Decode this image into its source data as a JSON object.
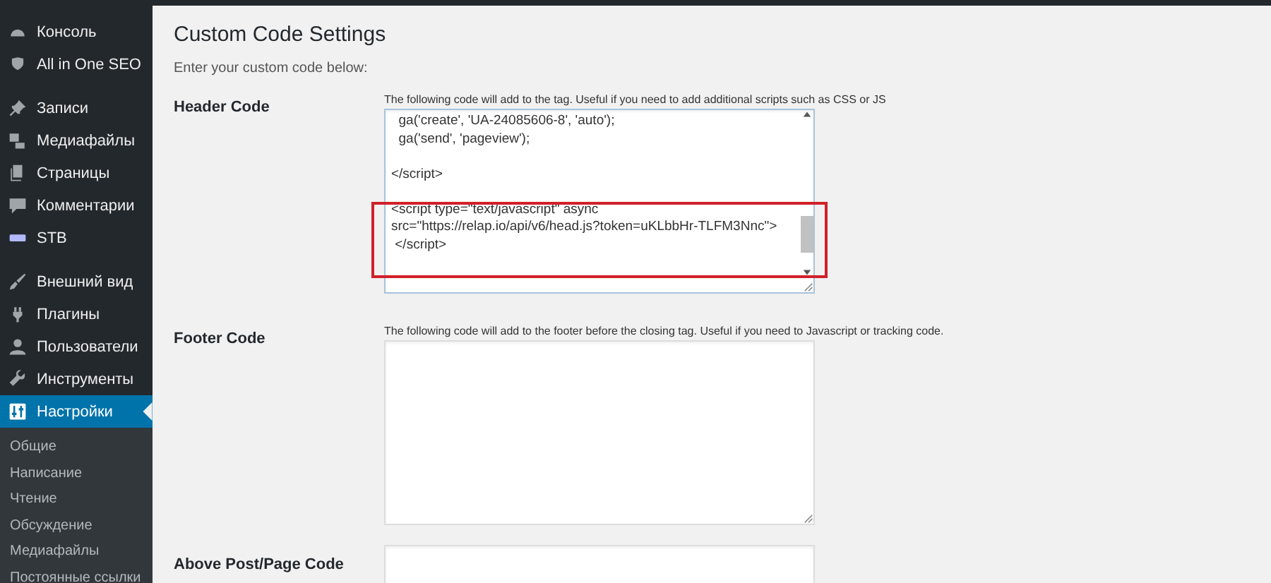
{
  "sidebar": {
    "groups": [
      {
        "items": [
          {
            "label": "Консоль",
            "kind": "gauge",
            "selected": false
          },
          {
            "label": "All in One SEO",
            "kind": "shield",
            "selected": false
          }
        ]
      },
      {
        "items": [
          {
            "label": "Записи",
            "kind": "pin",
            "selected": false
          },
          {
            "label": "Медиафайлы",
            "kind": "media",
            "selected": false
          },
          {
            "label": "Страницы",
            "kind": "pages",
            "selected": false
          },
          {
            "label": "Комментарии",
            "kind": "comment",
            "selected": false
          },
          {
            "label": "STB",
            "kind": "bar",
            "selected": false
          }
        ]
      },
      {
        "items": [
          {
            "label": "Внешний вид",
            "kind": "brush",
            "selected": false
          },
          {
            "label": "Плагины",
            "kind": "plug",
            "selected": false
          },
          {
            "label": "Пользователи",
            "kind": "user",
            "selected": false
          },
          {
            "label": "Инструменты",
            "kind": "wrench",
            "selected": false
          },
          {
            "label": "Настройки",
            "kind": "sliders",
            "selected": true
          }
        ]
      }
    ],
    "submenu": [
      {
        "label": "Общие",
        "selected": false
      },
      {
        "label": "Написание",
        "selected": false
      },
      {
        "label": "Чтение",
        "selected": false
      },
      {
        "label": "Обсуждение",
        "selected": false
      },
      {
        "label": "Медиафайлы",
        "selected": false
      },
      {
        "label": "Постоянные ссылки",
        "selected": false
      }
    ]
  },
  "page": {
    "title": "Custom Code Settings",
    "intro": "Enter your custom code below:",
    "fields": [
      {
        "label": "Header Code",
        "description": "The following code will add to the tag. Useful if you need to add additional scripts such as CSS or JS",
        "value": "  ga('create', 'UA-24085606-8', 'auto');\n  ga('send', 'pageview');\n\n</script>\n\n<script type=\"text/javascript\" async\nsrc=\"https://relap.io/api/v6/head.js?token=uKLbbHr-TLFM3Nnc\">\n </script>",
        "highlighted": true,
        "scrollable": true
      },
      {
        "label": "Footer Code",
        "description": "The following code will add to the footer before the closing tag. Useful if you need to Javascript or tracking code.",
        "highlighted": false,
        "scrollable": false
      },
      {
        "label": "Above Post/Page Code",
        "scrollable": false
      }
    ]
  }
}
